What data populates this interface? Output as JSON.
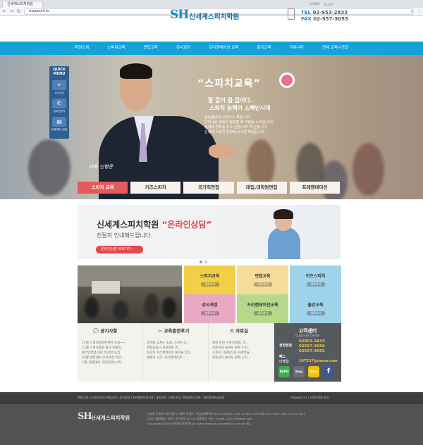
{
  "browser": {
    "tab_title": "신세계스피치학원",
    "url": "mspeech.kr",
    "back_icon": "back-arrow-icon",
    "forward_icon": "forward-arrow-icon",
    "reload_icon": "reload-icon"
  },
  "header": {
    "links": [
      "HOME",
      "로그인"
    ],
    "logo_mark": "SH",
    "logo_name": "신세계스피치학원",
    "tel_label": "TEL",
    "tel": "02-953-2833",
    "fax_label": "FAX",
    "fax": "02-557-3053"
  },
  "menu": [
    "학원소개",
    "스피치교육",
    "면접교육",
    "강사과정",
    "프리젠테이션 교육",
    "출강교육",
    "커뮤니티",
    "전체 교육시간표"
  ],
  "quick_menu": {
    "title_1": "QUICK",
    "title_2": "MENU",
    "items": [
      "오시는길",
      "온라인문의",
      "전체교육시간표"
    ]
  },
  "hero": {
    "title": "“스피치교육”",
    "sub1": "말 값이 몸 값이다.",
    "sub2": "스피치 능력이 스펙인시대",
    "lines": [
      "발표불안에 고민하고 계십니까?",
      "여러사람 앞에서 발표할 때 부담을 느끼십니까?",
      "성격에 변화를 주고 싶습니까? 확신합니다!",
      "신세계 스피치 학원에 오시면 해결됩니다."
    ],
    "signature": "대표 신병준",
    "tabs": [
      "스피치 교육",
      "키즈스피치",
      "국가직면접",
      "대입,대학원면접",
      "프레젠테이션"
    ],
    "active_tab": 0
  },
  "consult": {
    "title_main": "신세계스피치학원",
    "title_accent": "“온라인상담”",
    "sub": "친절히 안내해드립니다.",
    "button": "온라인상담 바로가기"
  },
  "tiles": [
    {
      "title": "스피치교육",
      "more": "바로가기",
      "bg": "#f2cf46",
      "color": "#333"
    },
    {
      "title": "면접교육",
      "more": "바로가기",
      "bg": "#f6dc9a",
      "color": "#333"
    },
    {
      "title": "키즈스피치",
      "more": "바로가기",
      "bg": "#9fd3ea",
      "color": "#333"
    },
    {
      "title": "강사과정",
      "more": "바로가기",
      "bg": "#e9a9c4",
      "color": "#333"
    },
    {
      "title": "프리젠테이션교육",
      "more": "바로가기",
      "bg": "#b4d98b",
      "color": "#333"
    },
    {
      "title": "출강교육",
      "more": "바로가기",
      "bg": "#9fd3ea",
      "color": "#333"
    }
  ],
  "boards": [
    {
      "icon": "chat-icon",
      "title": "공지사항",
      "lines": [
        "11월 스피치종합완성반 모집~~",
        "11월 스피치종합 정규 진행과...",
        "온라인면접 대비 특강반 모집",
        "10월 면접대비 모의면접 특강...",
        "각종 면접대비 가인동영상 (특..."
      ]
    },
    {
      "icon": "monitor-icon",
      "title": "교육훈련후기",
      "lines": [
        "성격을 고치는 효과, 스피치 능...",
        "면접교육/스피치관련 특...",
        "최고의 프리젠테이션 훈련을 받고...",
        "발표의 시간, 프리젠테이션..."
      ]
    },
    {
      "icon": "gear-icon",
      "title": "자료실",
      "lines": [
        "최강 훈련 스피치방법, 비...",
        "전문강좌 놓쳐도 판에 스피...",
        "스피치 기본동작과 자세연습...",
        "전문강좌 놓쳐도 판에 스피..."
      ]
    }
  ],
  "customer_center": {
    "title": "고객센터",
    "sub": "Customer Center",
    "phone_label": "전화번호",
    "phones": [
      "02953-2833",
      "02557-3050",
      "02557-3053"
    ],
    "fax_label": "팩스",
    "email_label": "이메일",
    "email": "147237@naver.com",
    "sns": [
      {
        "name": "band-icon",
        "label": "BAND",
        "color": "#36b24a"
      },
      {
        "name": "blog-icon",
        "label": "blog",
        "color": "#6b6f75"
      },
      {
        "name": "kakaostory-icon",
        "label": "story",
        "color": "#f1c40f"
      },
      {
        "name": "facebook-icon",
        "label": "f",
        "color": "#3b5998"
      }
    ]
  },
  "footer": {
    "nav": "학원소개 | 스피치교육 | 면접교육 | 강사과정 | 프리젠테이션교육 | 출강교육 | 커뮤니티 | 전체교육시간표 | 개인정보취급방침",
    "nav_right": "mspeech.kr | 스피치학원 한국",
    "logo_mark": "SH",
    "logo_name": "신세계스피치학원",
    "info": [
      "상호명 신세계스피치학원 | 대표자 신병준 | 사업자등록번호 472-91-00260 | TEL 02-953-2833(대표) 557-3050 | FAX 02-557-3053",
      "ADD 서울특별시 성북구 동소문동 4가 271(동문빌딩 3층) | E-mail 147237@naver.com",
      "Copyright(c)2016 신세계스피치학원 All rights reserved. powered by Sunrise INC."
    ]
  }
}
